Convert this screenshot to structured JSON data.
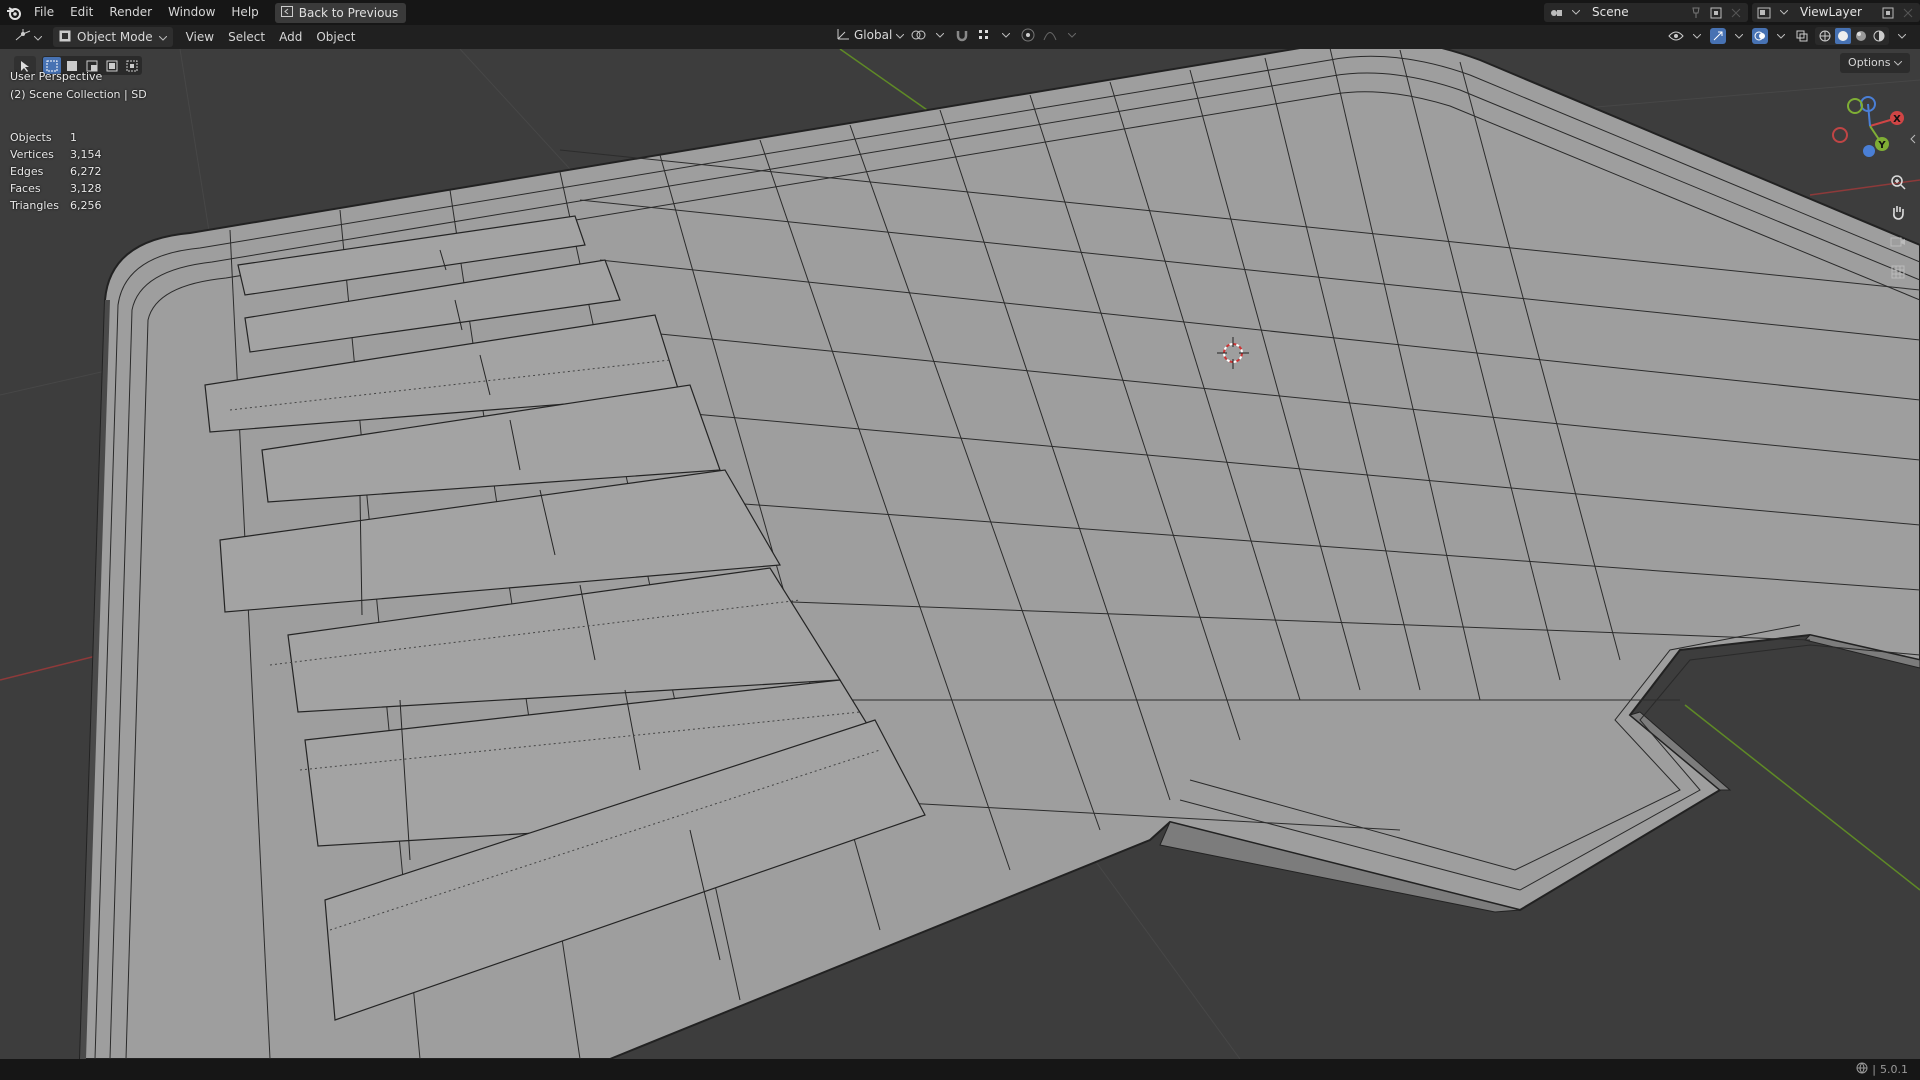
{
  "topbar": {
    "menus": [
      "File",
      "Edit",
      "Render",
      "Window",
      "Help"
    ],
    "back_button": "Back to Previous",
    "scene_name": "Scene",
    "view_layer": "ViewLayer"
  },
  "header": {
    "mode": "Object Mode",
    "menus": [
      "View",
      "Select",
      "Add",
      "Object"
    ],
    "transform_orientation": "Global"
  },
  "viewport": {
    "perspective": "User Perspective",
    "collection": "(2) Scene Collection | SD",
    "options_label": "Options",
    "stats": [
      {
        "label": "Objects",
        "value": "1"
      },
      {
        "label": "Vertices",
        "value": "3,154"
      },
      {
        "label": "Edges",
        "value": "6,272"
      },
      {
        "label": "Faces",
        "value": "3,128"
      },
      {
        "label": "Triangles",
        "value": "6,256"
      }
    ],
    "gizmo_axes": {
      "x": "X",
      "y": "Y"
    }
  },
  "statusbar": {
    "version": "5.0.1"
  },
  "colors": {
    "accent": "#4772b3",
    "mesh_face": "#9e9e9e",
    "wire": "#1c1c1c",
    "axis_x": "#c04040",
    "axis_y": "#6a9a2a"
  }
}
